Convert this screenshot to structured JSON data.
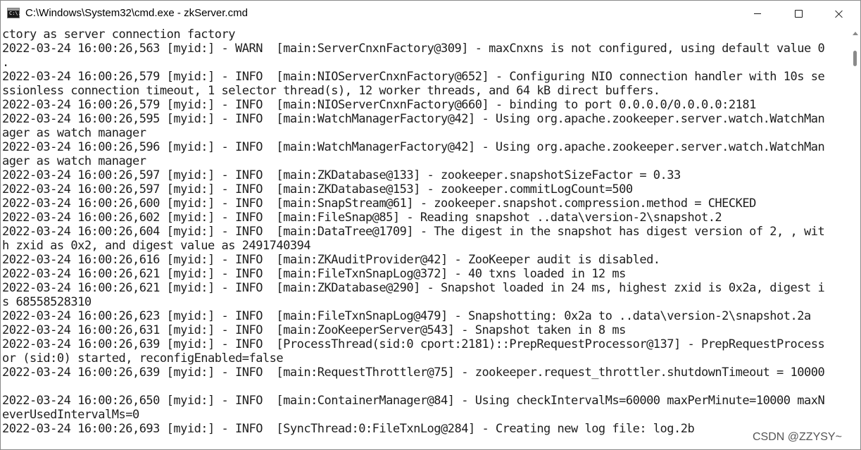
{
  "window": {
    "title": "C:\\Windows\\System32\\cmd.exe - zkServer.cmd",
    "app_icon_glyph": "C:\\."
  },
  "console": {
    "lines": [
      "ctory as server connection factory",
      "2022-03-24 16:00:26,563 [myid:] - WARN  [main:ServerCnxnFactory@309] - maxCnxns is not configured, using default value 0",
      ".",
      "2022-03-24 16:00:26,579 [myid:] - INFO  [main:NIOServerCnxnFactory@652] - Configuring NIO connection handler with 10s se",
      "ssionless connection timeout, 1 selector thread(s), 12 worker threads, and 64 kB direct buffers.",
      "2022-03-24 16:00:26,579 [myid:] - INFO  [main:NIOServerCnxnFactory@660] - binding to port 0.0.0.0/0.0.0.0:2181",
      "2022-03-24 16:00:26,595 [myid:] - INFO  [main:WatchManagerFactory@42] - Using org.apache.zookeeper.server.watch.WatchMan",
      "ager as watch manager",
      "2022-03-24 16:00:26,596 [myid:] - INFO  [main:WatchManagerFactory@42] - Using org.apache.zookeeper.server.watch.WatchMan",
      "ager as watch manager",
      "2022-03-24 16:00:26,597 [myid:] - INFO  [main:ZKDatabase@133] - zookeeper.snapshotSizeFactor = 0.33",
      "2022-03-24 16:00:26,597 [myid:] - INFO  [main:ZKDatabase@153] - zookeeper.commitLogCount=500",
      "2022-03-24 16:00:26,600 [myid:] - INFO  [main:SnapStream@61] - zookeeper.snapshot.compression.method = CHECKED",
      "2022-03-24 16:00:26,602 [myid:] - INFO  [main:FileSnap@85] - Reading snapshot ..data\\version-2\\snapshot.2",
      "2022-03-24 16:00:26,604 [myid:] - INFO  [main:DataTree@1709] - The digest in the snapshot has digest version of 2, , wit",
      "h zxid as 0x2, and digest value as 2491740394",
      "2022-03-24 16:00:26,616 [myid:] - INFO  [main:ZKAuditProvider@42] - ZooKeeper audit is disabled.",
      "2022-03-24 16:00:26,621 [myid:] - INFO  [main:FileTxnSnapLog@372] - 40 txns loaded in 12 ms",
      "2022-03-24 16:00:26,621 [myid:] - INFO  [main:ZKDatabase@290] - Snapshot loaded in 24 ms, highest zxid is 0x2a, digest i",
      "s 68558528310",
      "2022-03-24 16:00:26,623 [myid:] - INFO  [main:FileTxnSnapLog@479] - Snapshotting: 0x2a to ..data\\version-2\\snapshot.2a",
      "2022-03-24 16:00:26,631 [myid:] - INFO  [main:ZooKeeperServer@543] - Snapshot taken in 8 ms",
      "2022-03-24 16:00:26,639 [myid:] - INFO  [ProcessThread(sid:0 cport:2181)::PrepRequestProcessor@137] - PrepRequestProcess",
      "or (sid:0) started, reconfigEnabled=false",
      "2022-03-24 16:00:26,639 [myid:] - INFO  [main:RequestThrottler@75] - zookeeper.request_throttler.shutdownTimeout = 10000",
      "",
      "2022-03-24 16:00:26,650 [myid:] - INFO  [main:ContainerManager@84] - Using checkIntervalMs=60000 maxPerMinute=10000 maxN",
      "everUsedIntervalMs=0",
      "2022-03-24 16:00:26,693 [myid:] - INFO  [SyncThread:0:FileTxnLog@284] - Creating new log file: log.2b"
    ]
  },
  "watermark": {
    "text": "CSDN @ZZYSY~"
  }
}
